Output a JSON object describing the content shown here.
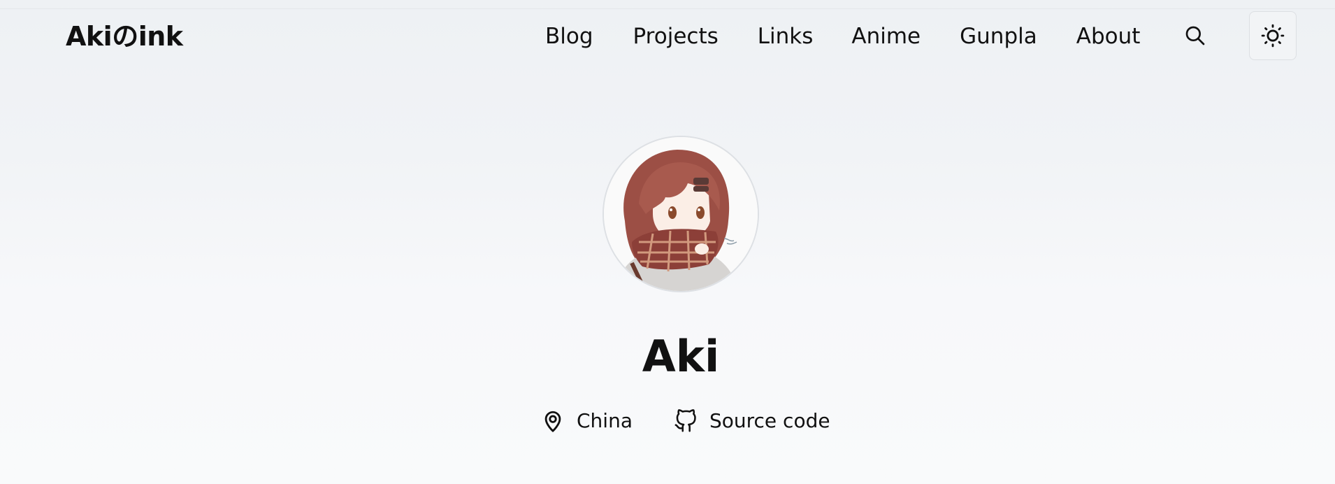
{
  "site": {
    "logo": "Akiのink"
  },
  "nav": {
    "items": [
      {
        "label": "Blog"
      },
      {
        "label": "Projects"
      },
      {
        "label": "Links"
      },
      {
        "label": "Anime"
      },
      {
        "label": "Gunpla"
      },
      {
        "label": "About"
      }
    ],
    "search_icon": "search-icon",
    "theme_icon": "sun-icon"
  },
  "profile": {
    "avatar_icon": "avatar-illustration",
    "name": "Aki",
    "location": "China",
    "location_icon": "map-pin-icon",
    "source_label": "Source code",
    "source_icon": "github-icon"
  },
  "colors": {
    "text": "#111111",
    "background_top": "#eef1f4",
    "background_bottom": "#f9fafb",
    "avatar_hair": "#a2574b",
    "scarf": "#8c3f38"
  }
}
